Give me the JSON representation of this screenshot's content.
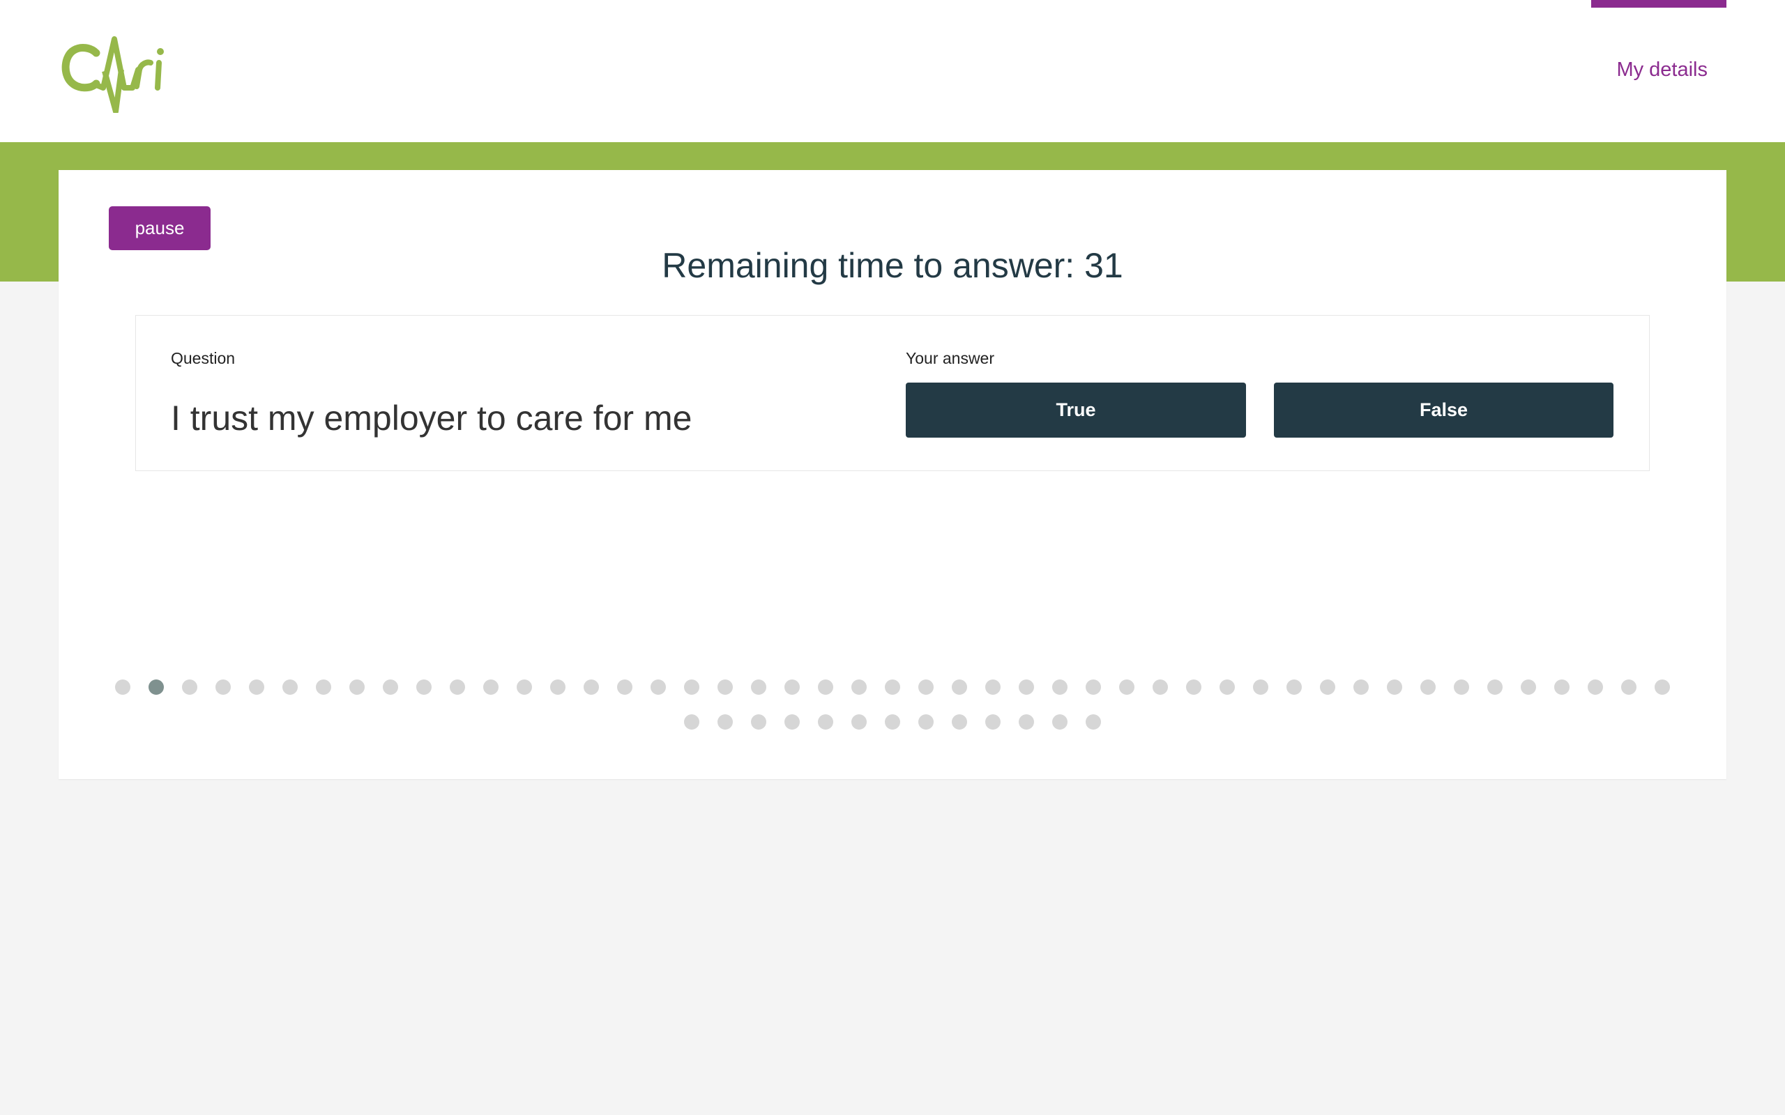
{
  "header": {
    "logo_text": "CAri",
    "nav_link": "My details",
    "colors": {
      "brand_purple": "#8b2b8f",
      "brand_green": "#96b84a",
      "dark": "#233a45"
    }
  },
  "quiz": {
    "pause_label": "pause",
    "timer_text": "Remaining time to answer: 31",
    "question_label": "Question",
    "question_text": "I trust my employer to care for me",
    "answer_label": "Your answer",
    "answers": [
      "True",
      "False"
    ]
  },
  "progress": {
    "total_questions": 60,
    "current_index": 2
  }
}
